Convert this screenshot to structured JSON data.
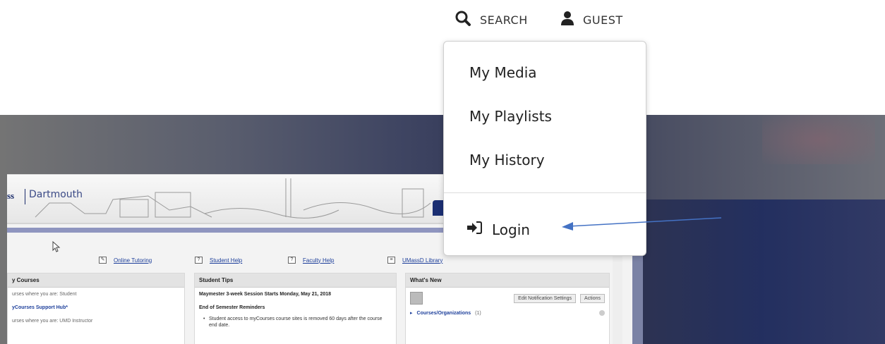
{
  "nav": {
    "search_label": "SEARCH",
    "guest_label": "GUEST",
    "search_icon": "search-icon",
    "user_icon": "user-icon"
  },
  "menu": {
    "items": [
      {
        "label": "My Media"
      },
      {
        "label": "My Playlists"
      },
      {
        "label": "My History"
      }
    ],
    "login_label": "Login",
    "login_icon": "sign-in-icon"
  },
  "background_screenshot": {
    "school_mark": "ss",
    "school_name": "Dartmouth",
    "links": [
      {
        "label": "Online Tutoring"
      },
      {
        "label": "Student Help"
      },
      {
        "label": "Faculty Help"
      },
      {
        "label": "UMassD Library"
      }
    ],
    "courses_panel": {
      "title": "y Courses",
      "lines": [
        "urses where you are: Student",
        "yCourses Support Hub*",
        "urses where you are: UMD Instructor"
      ]
    },
    "tips_panel": {
      "title": "Student Tips",
      "headline": "Maymester 3-week Session Starts Monday, May 21, 2018",
      "subhead": "End of Semester Reminders",
      "bullet": "Student access to myCourses course sites is removed 60 days after the course end date."
    },
    "new_panel": {
      "title": "What's New",
      "edit_button": "Edit Notification Settings",
      "actions_button": "Actions",
      "row_label": "Courses/Organizations",
      "row_count": "(1)"
    }
  },
  "colors": {
    "accent_arrow": "#4472c4",
    "nav_text": "#333333",
    "menu_border": "#cfcfcf"
  }
}
